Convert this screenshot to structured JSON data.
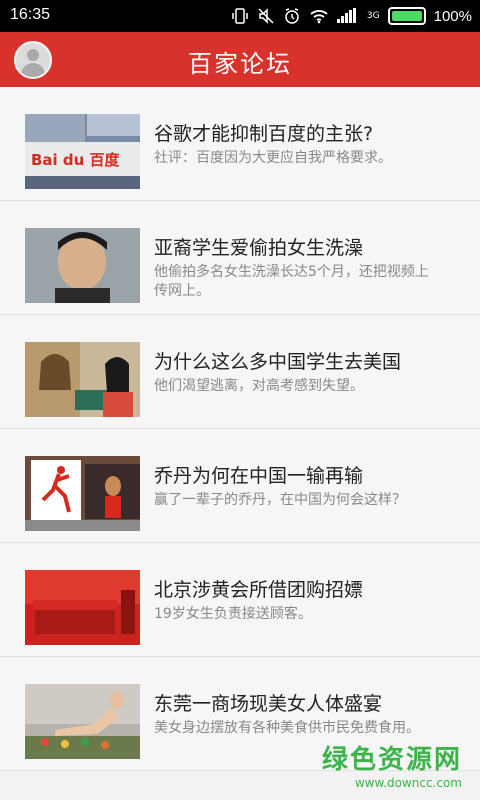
{
  "status_bar": {
    "time": "16:35",
    "network_label": "3G",
    "battery_percent": "100%"
  },
  "header": {
    "title": "百家论坛"
  },
  "articles": [
    {
      "title": "谷歌才能抑制百度的主张?",
      "description": "社评：百度因为大更应自我严格要求。",
      "thumb_text": "Bai du 百度"
    },
    {
      "title": "亚裔学生爱偷拍女生洗澡",
      "description": "他偷拍多名女生洗澡长达5个月，还把视频上传网上。"
    },
    {
      "title": "为什么这么多中国学生去美国",
      "description": "他们渴望逃离，对高考感到失望。"
    },
    {
      "title": "乔丹为何在中国一输再输",
      "description": "赢了一辈子的乔丹，在中国为何会这样？"
    },
    {
      "title": "北京涉黄会所借团购招嫖",
      "description": "19岁女生负责接送顾客。"
    },
    {
      "title": "东莞一商场现美女人体盛宴",
      "description": "美女身边摆放有各种美食供市民免费食用。"
    }
  ],
  "watermark": {
    "main": "绿色资源网",
    "url": "www.downcc.com"
  }
}
